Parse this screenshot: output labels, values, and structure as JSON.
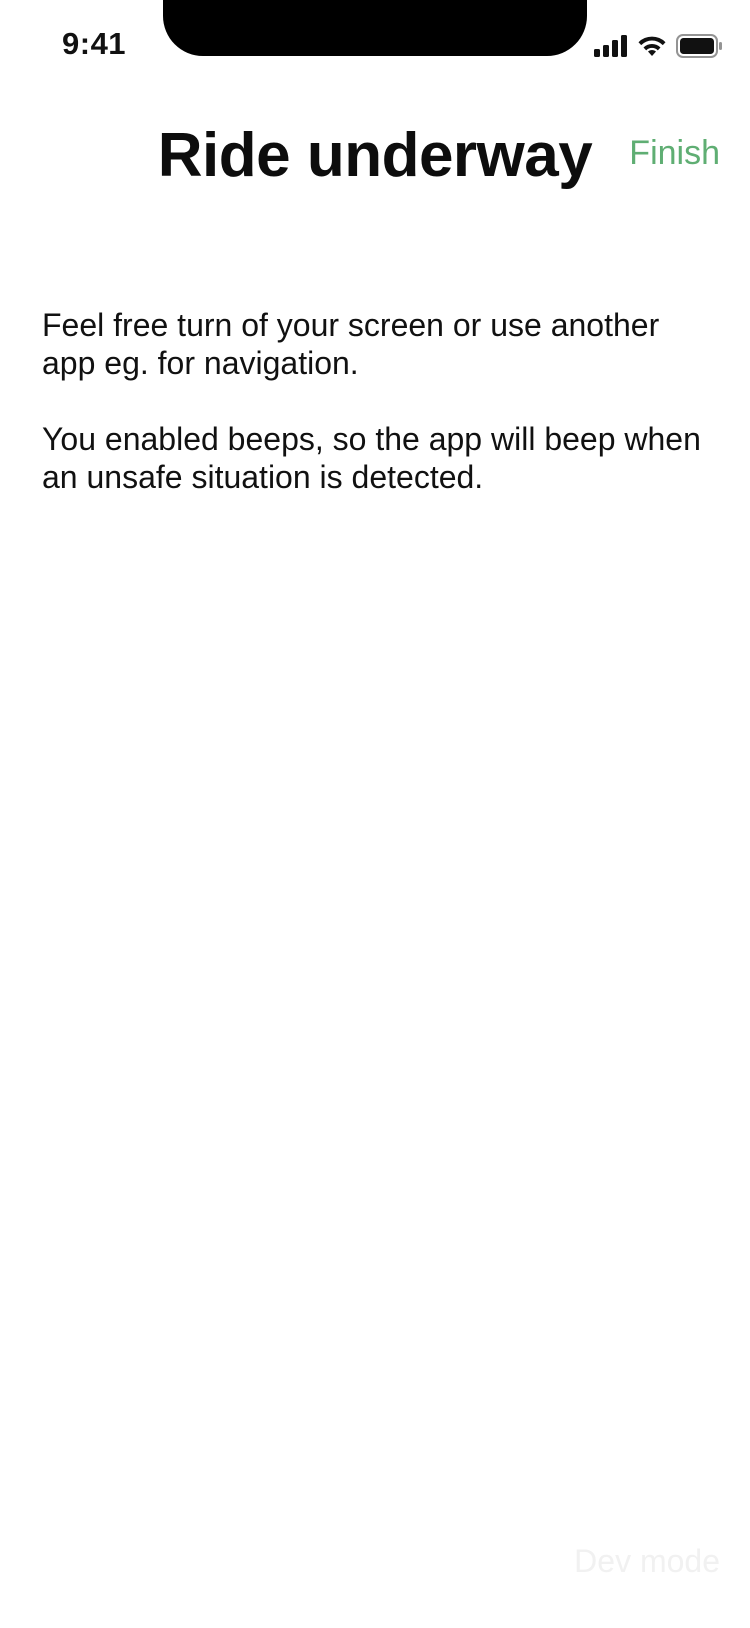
{
  "status_bar": {
    "time": "9:41",
    "icons": [
      "cellular-signal-icon",
      "wifi-icon",
      "battery-icon"
    ]
  },
  "header": {
    "title": "Ride underway",
    "finish_label": "Finish"
  },
  "body": {
    "paragraph_1": "Feel free turn of your screen or use another app eg. for navigation.",
    "paragraph_2": "You enabled beeps, so the app will beep when an unsafe situation is detected."
  },
  "footer": {
    "dev_mode_label": "Dev mode"
  },
  "colors": {
    "accent": "#5fae73",
    "text": "#111111",
    "background": "#ffffff",
    "dev_mode_text": "#f1f1f1"
  }
}
